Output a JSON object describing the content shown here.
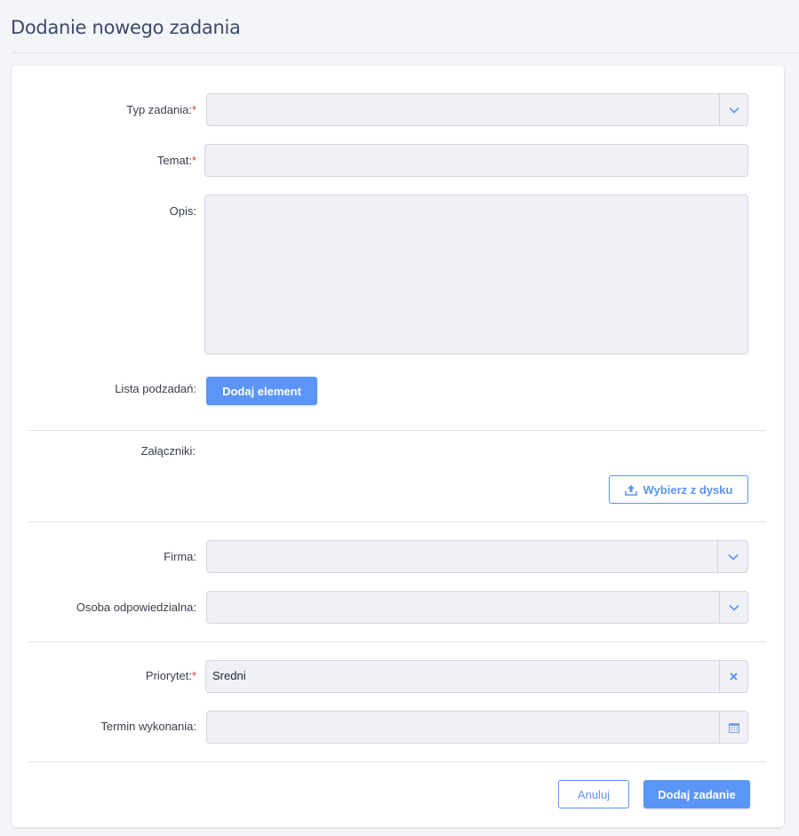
{
  "header": {
    "title": "Dodanie nowego zadania"
  },
  "form": {
    "task_type": {
      "label": "Typ zadania:",
      "required_mark": "*",
      "value": "",
      "icon": "chevron-down-icon"
    },
    "subject": {
      "label": "Temat:",
      "required_mark": "*",
      "value": ""
    },
    "description": {
      "label": "Opis:",
      "value": ""
    },
    "subtasks": {
      "label": "Lista podzadań:",
      "add_button_label": "Dodaj element"
    },
    "attachments": {
      "label": "Załączniki:",
      "upload_button_label": "Wybierz z dysku",
      "upload_icon": "upload-icon"
    },
    "company": {
      "label": "Firma:",
      "value": "",
      "icon": "chevron-down-icon"
    },
    "responsible_person": {
      "label": "Osoba odpowiedzialna:",
      "value": "",
      "icon": "chevron-down-icon"
    },
    "priority": {
      "label": "Priorytet:",
      "required_mark": "*",
      "value": "Sredni",
      "icon": "clear-icon"
    },
    "due_date": {
      "label": "Termin wykonania:",
      "value": "",
      "icon": "calendar-icon"
    }
  },
  "actions": {
    "cancel_label": "Anuluj",
    "submit_label": "Dodaj zadanie"
  },
  "colors": {
    "accent": "#5b95f7",
    "required": "#d9334a",
    "field_bg": "#f0f1f6",
    "title": "#3d4a6b"
  }
}
